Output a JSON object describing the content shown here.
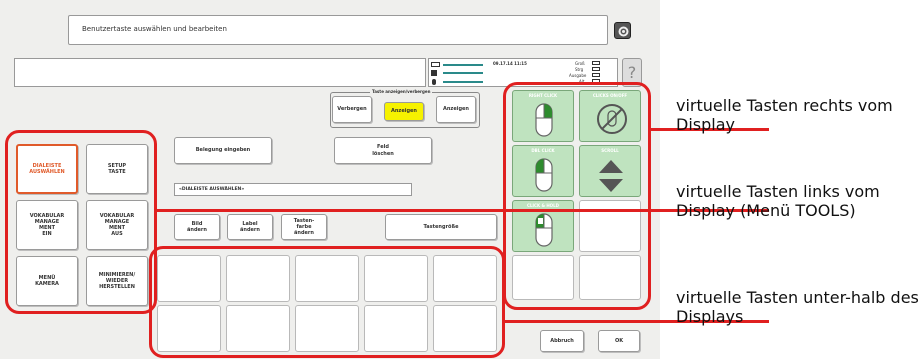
{
  "title_bar": {
    "text": "Benutzertaste auswählen und bearbeiten",
    "icon": "gear-icon"
  },
  "status": {
    "datetime": "09.17.14 11:15",
    "labels": [
      "Groß",
      "Strg",
      "Ausgabe",
      "Alt"
    ],
    "help": "?",
    "battery_icon": "battery-icon",
    "volume_icon": "speaker-icon",
    "mic_icon": "microphone-icon"
  },
  "toggle_group": {
    "label": "Taste anzeigen/verbergen",
    "buttons": [
      "Verbergen",
      "Anzeigen",
      "Anzeigen"
    ]
  },
  "actions": {
    "assign": "Belegung eingeben",
    "clear": "Feld\nlöschen",
    "field_value": "«DIALEISTE AUSWÄHLEN»",
    "image": "Bild\nändern",
    "label": "Label\nändern",
    "color": "Tasten-\nfarbe\nändern",
    "size": "Tastengröße"
  },
  "left_keys": [
    "DIALEISTE\nAUSWÄHLEN",
    "SETUP\nTASTE",
    "VOKABULAR\nMANAGE\nMENT\nEIN",
    "VOKABULAR\nMANAGE\nMENT\nAUS",
    "MENÜ\nKAMERA",
    "MINIMIEREN/\nWIEDER\nHERSTELLEN"
  ],
  "right_keys": [
    "RIGHT CLICK",
    "CLICKS ON/OFF",
    "DBL CLICK",
    "SCROLL",
    "CLICK & HOLD"
  ],
  "footer": {
    "cancel": "Abbruch",
    "ok": "OK"
  },
  "annotations": {
    "right": "virtuelle Tasten rechts vom Display",
    "left": "virtuelle Tasten links vom Display (Menü TOOLS)",
    "bottom": "virtuelle Tasten unter-halb des Displays"
  },
  "colors": {
    "accent_red": "#e02020",
    "selected_orange": "#e05a2a",
    "key_green": "#bfe3bf",
    "active_yellow": "#f6f200"
  }
}
